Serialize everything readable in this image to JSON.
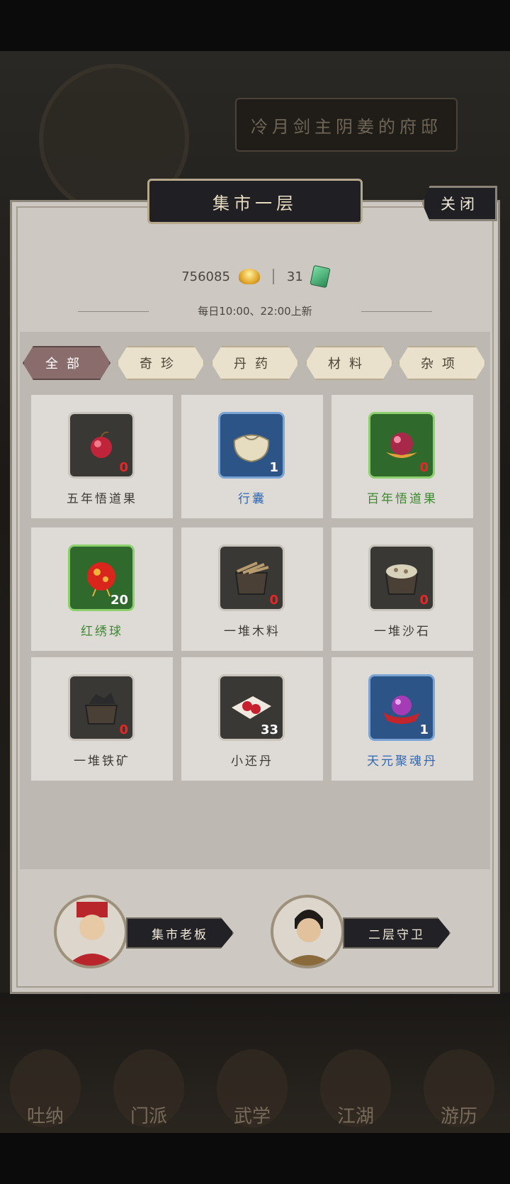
{
  "background": {
    "plaque_text": "冷月剑主阴姜的府邸",
    "nav": [
      "吐纳",
      "门派",
      "武学",
      "江湖",
      "游历"
    ]
  },
  "panel": {
    "title": "集市一层",
    "close_label": "关闭",
    "gold_amount": "756085",
    "jade_amount": "31",
    "refresh_note": "每日10:00、22:00上新"
  },
  "tabs": [
    {
      "label": "全部",
      "active": true
    },
    {
      "label": "奇珍",
      "active": false
    },
    {
      "label": "丹药",
      "active": false
    },
    {
      "label": "材料",
      "active": false
    },
    {
      "label": "杂项",
      "active": false
    }
  ],
  "items": [
    {
      "name": "五年悟道果",
      "qty": "0",
      "rarity": "gray",
      "icon": "red-fruit-icon"
    },
    {
      "name": "行囊",
      "qty": "1",
      "rarity": "blue",
      "icon": "cloth-bag-icon"
    },
    {
      "name": "百年悟道果",
      "qty": "0",
      "rarity": "green",
      "icon": "lotus-fruit-icon"
    },
    {
      "name": "红绣球",
      "qty": "20",
      "rarity": "green",
      "icon": "red-embroidered-ball-icon"
    },
    {
      "name": "一堆木料",
      "qty": "0",
      "rarity": "gray",
      "icon": "wood-crate-icon"
    },
    {
      "name": "一堆沙石",
      "qty": "0",
      "rarity": "gray",
      "icon": "sand-crate-icon"
    },
    {
      "name": "一堆铁矿",
      "qty": "0",
      "rarity": "gray",
      "icon": "iron-crate-icon"
    },
    {
      "name": "小还丹",
      "qty": "33",
      "rarity": "gray",
      "icon": "red-pills-icon"
    },
    {
      "name": "天元聚魂丹",
      "qty": "1",
      "rarity": "blue",
      "icon": "purple-orb-icon"
    }
  ],
  "npcs": [
    {
      "label": "集市老板"
    },
    {
      "label": "二层守卫"
    }
  ],
  "colors": {
    "panel_bg": "#cdc9c2",
    "blue_rarity": "#2f67b6",
    "green_rarity": "#3a8a2e",
    "qty_zero": "#e02a2a"
  }
}
